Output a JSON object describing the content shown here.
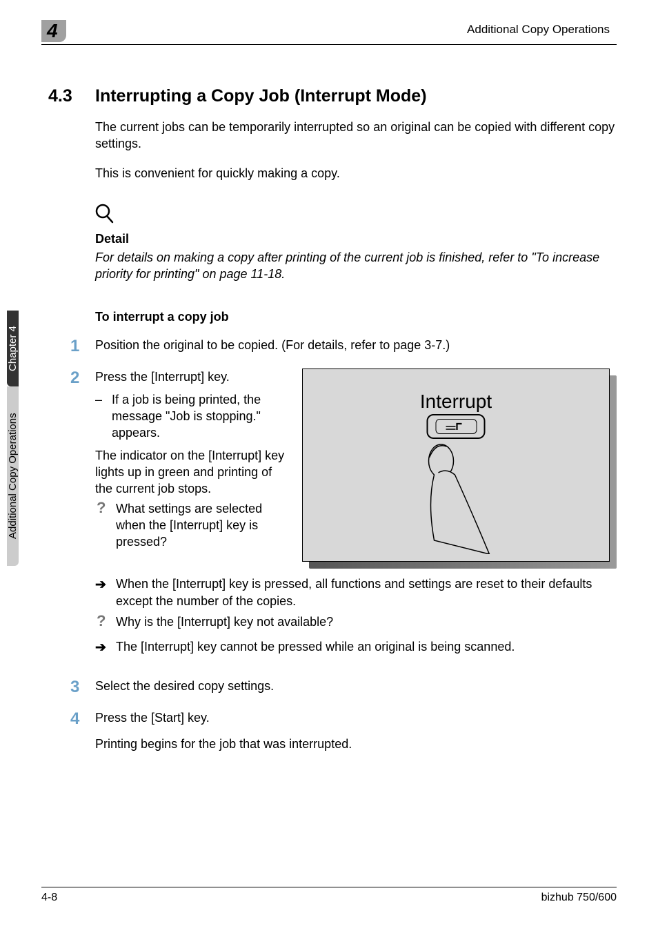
{
  "header": {
    "chapter_num": "4",
    "running_title": "Additional Copy Operations"
  },
  "sidebar": {
    "chapter_label": "Chapter 4",
    "section_label": "Additional Copy Operations"
  },
  "section": {
    "number": "4.3",
    "title": "Interrupting a Copy Job (Interrupt Mode)",
    "intro1": "The current jobs can be temporarily interrupted so an original can be copied with different copy settings.",
    "intro2": "This is convenient for quickly making a copy."
  },
  "detail": {
    "heading": "Detail",
    "text": "For details on making a copy after printing of the current job is finished, refer to \"To increase priority for printing\" on page 11-18."
  },
  "procedure": {
    "heading": "To interrupt a copy job",
    "steps": [
      {
        "num": "1",
        "text": "Position the original to be copied. (For details, refer to page 3-7.)"
      },
      {
        "num": "2",
        "text": "Press the [Interrupt] key."
      },
      {
        "num": "3",
        "text": "Select the desired copy settings."
      },
      {
        "num": "4",
        "text": "Press the [Start] key."
      }
    ],
    "step2": {
      "bullet": "If a job is being printed, the message \"Job is stopping.\" appears.",
      "after_bullet": "The indicator on the [Interrupt] key lights up in green and printing of the current job stops.",
      "q1": "What settings are selected when the [Interrupt] key is pressed?",
      "a1": "When the [Interrupt] key is pressed, all functions and settings are reset to their defaults except the number of the copies.",
      "q2": "Why is the [Interrupt] key not available?",
      "a2": "The [Interrupt] key cannot be pressed while an original is being scanned."
    },
    "step4_after": "Printing begins for the job that was interrupted."
  },
  "illustration": {
    "label": "Interrupt",
    "key_glyph": "�json"
  },
  "footer": {
    "page": "4-8",
    "model": "bizhub 750/600"
  },
  "glyphs": {
    "dash": "–",
    "question": "?",
    "arrow": "➔"
  }
}
